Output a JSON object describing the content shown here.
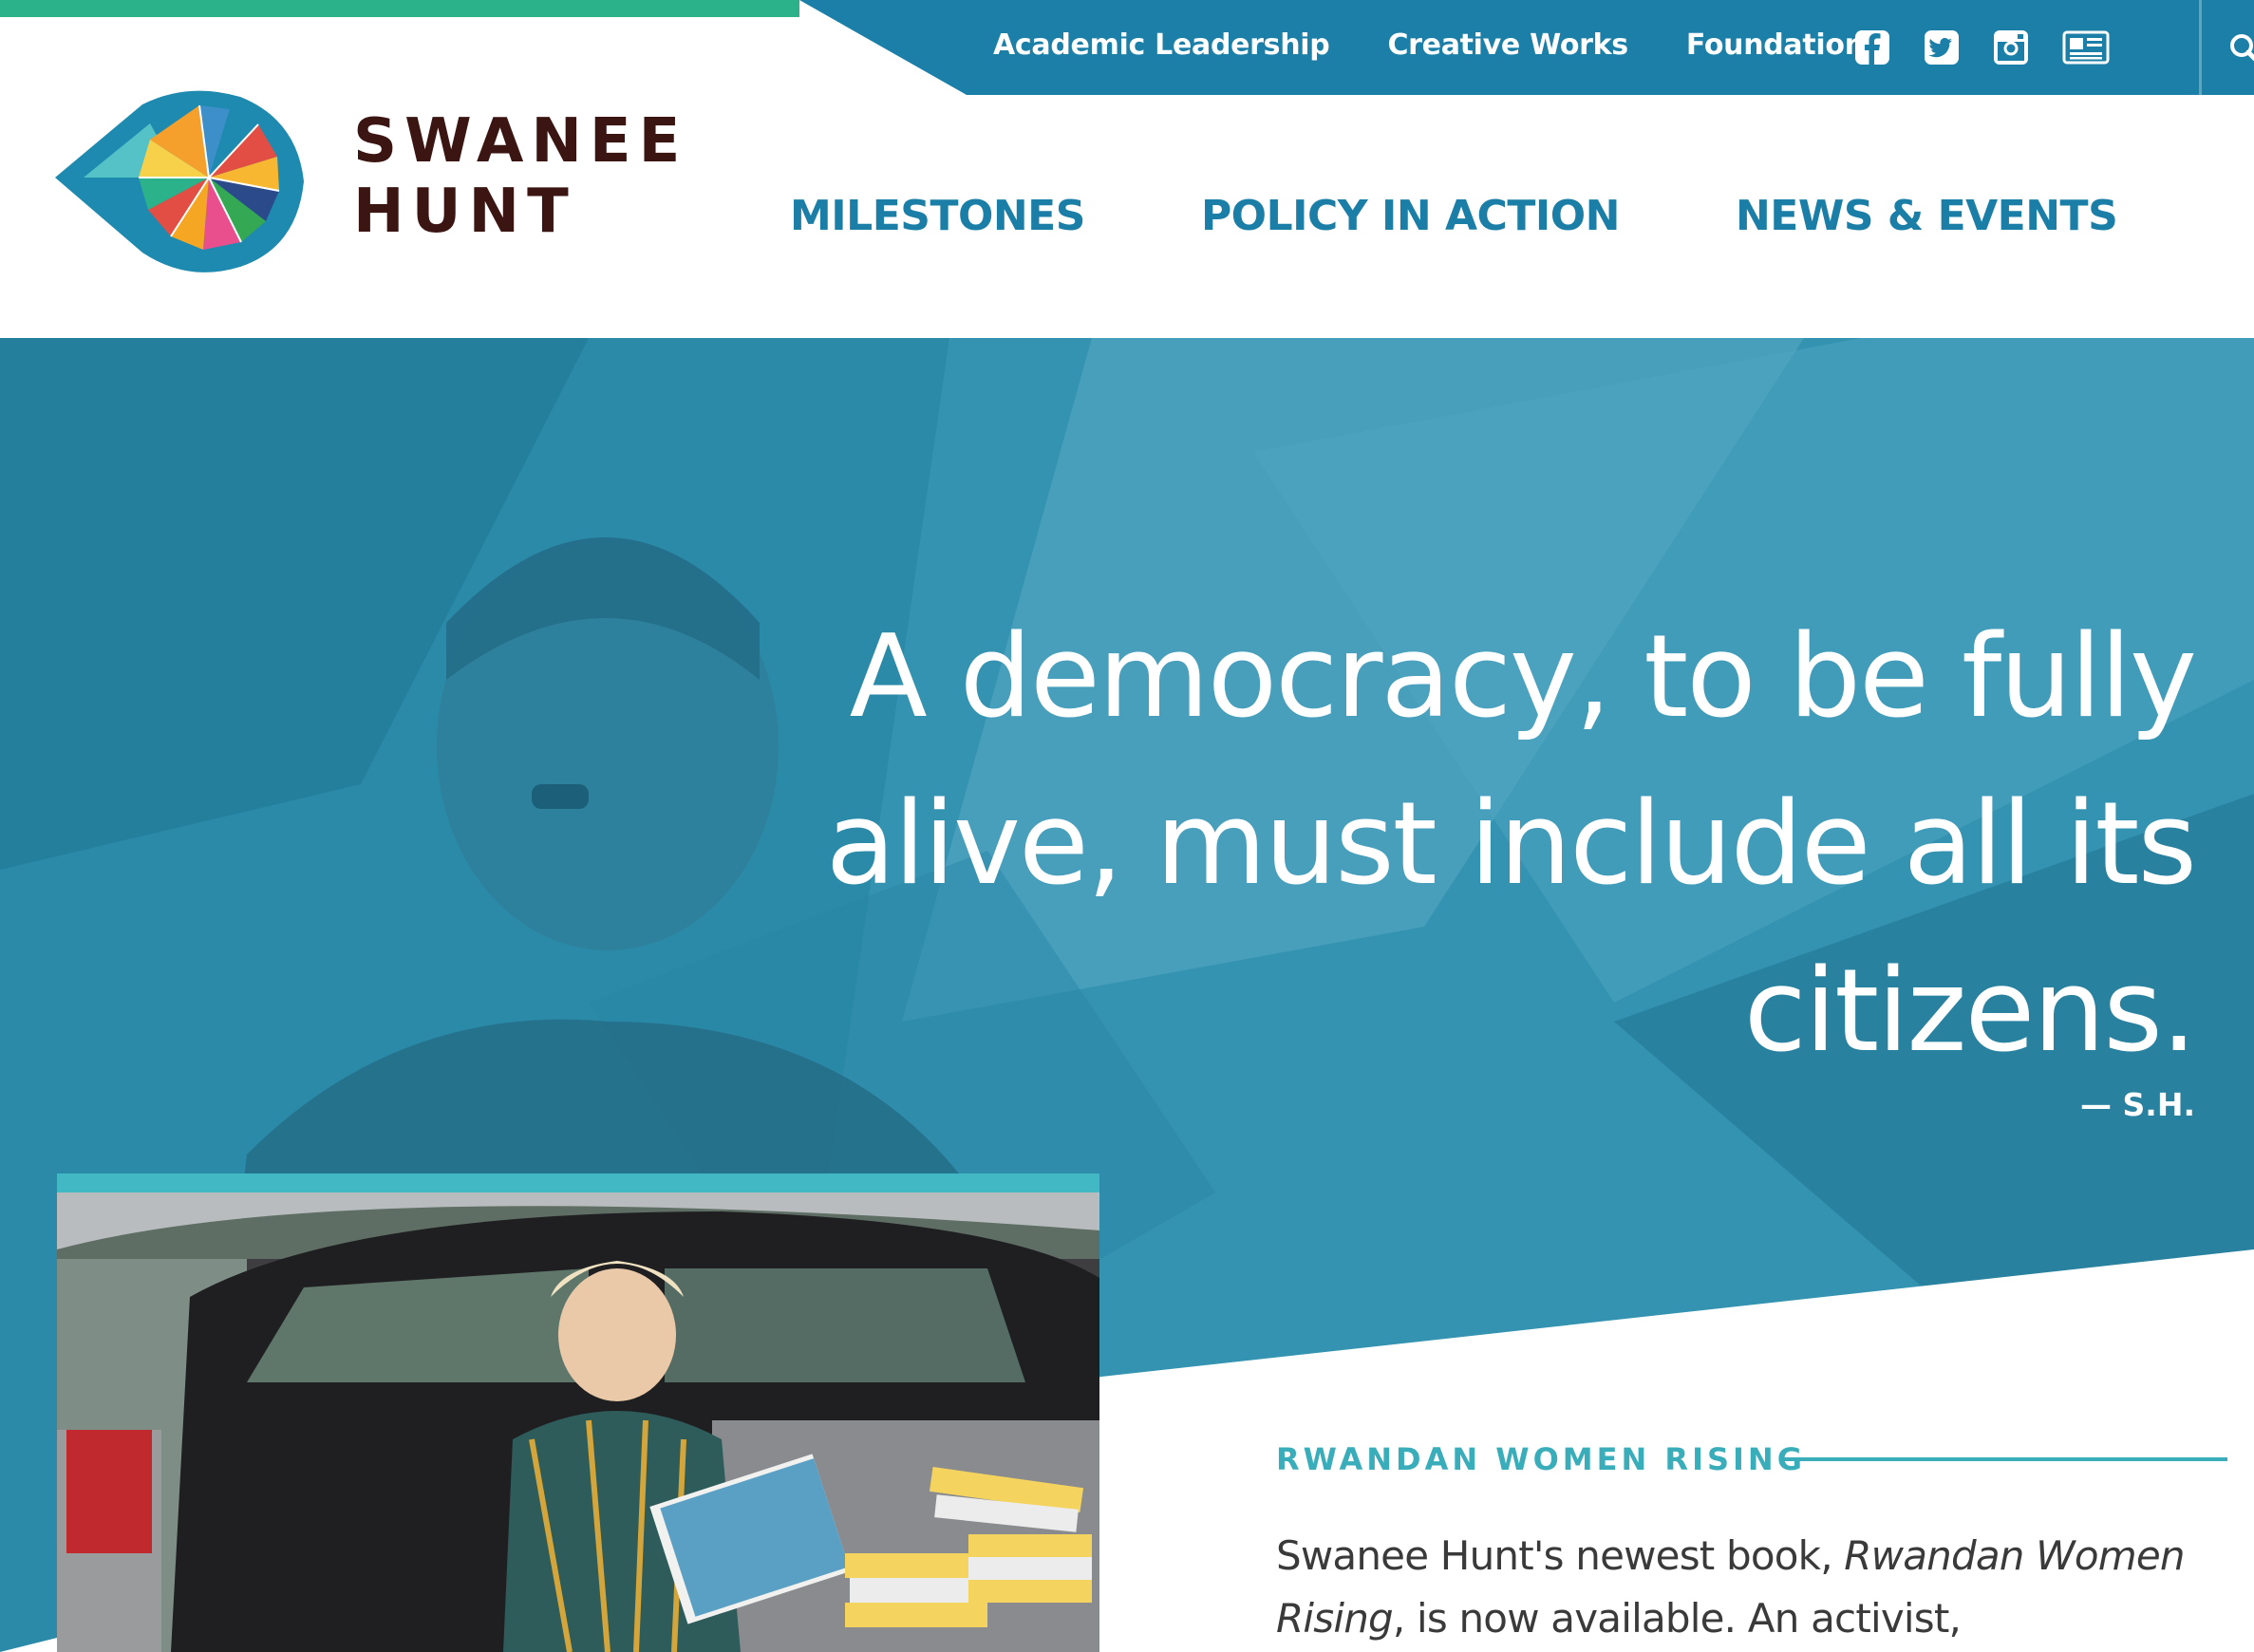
{
  "topbar": {
    "links": [
      "Academic Leadership",
      "Creative Works",
      "Foundation"
    ],
    "social_icons": [
      "facebook-icon",
      "twitter-icon",
      "instagram-icon",
      "newspaper-icon"
    ],
    "search_icon": "search-icon",
    "colors": {
      "bar": "#1b7fa7",
      "strip": "#2bb28a"
    }
  },
  "header": {
    "logo_line1": "SWANEE",
    "logo_line2": "HUNT",
    "nav": [
      "MILESTONES",
      "POLICY IN ACTION",
      "NEWS & EVENTS"
    ],
    "colors": {
      "logo_text": "#3a1512",
      "nav": "#1a7ea6"
    }
  },
  "hero": {
    "quote": "A democracy, to be fully alive, must include all its citizens.",
    "attribution": "— S.H.",
    "overlay_color": "#1e7e9e"
  },
  "feature": {
    "heading": "RWANDAN WOMEN RISING",
    "body_prefix": "Swanee Hunt's newest book, ",
    "body_title": "Rwandan Women Rising",
    "body_suffix": ", is now available. An activist,",
    "accent": "#3aadbb"
  }
}
